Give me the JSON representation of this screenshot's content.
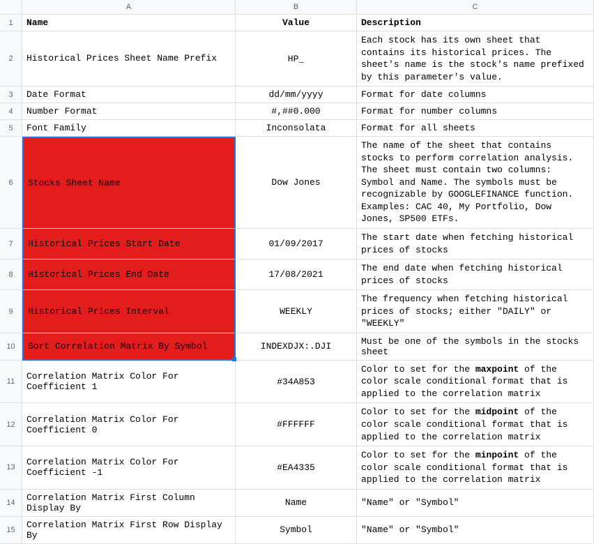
{
  "columns": [
    "A",
    "B",
    "C"
  ],
  "header": {
    "a": "Name",
    "b": "Value",
    "c": "Description"
  },
  "rows": [
    {
      "n": "2",
      "a": "Historical Prices Sheet Name Prefix",
      "b": "HP_",
      "c": "Each stock has its own sheet that contains its historical prices. The sheet's name is the stock's name prefixed by this parameter's value."
    },
    {
      "n": "3",
      "a": "Date Format",
      "b": "dd/mm/yyyy",
      "c": "Format for date columns"
    },
    {
      "n": "4",
      "a": "Number Format",
      "b": "#,##0.000",
      "c": "Format for number columns"
    },
    {
      "n": "5",
      "a": "Font Family",
      "b": "Inconsolata",
      "c": "Format for all sheets"
    },
    {
      "n": "6",
      "a": "Stocks Sheet Name",
      "b": "Dow Jones",
      "c": "The name of the sheet that contains stocks to perform correlation analysis. The sheet must contain two columns: Symbol and Name. The symbols must be recognizable by GOOGLEFINANCE function. Examples: CAC 40, My Portfolio, Dow Jones, SP500 ETFs."
    },
    {
      "n": "7",
      "a": "Historical Prices Start Date",
      "b": "01/09/2017",
      "c": "The start date when fetching historical prices of stocks"
    },
    {
      "n": "8",
      "a": "Historical Prices End Date",
      "b": "17/08/2021",
      "c": "The end date when fetching historical prices of stocks"
    },
    {
      "n": "9",
      "a": "Historical Prices Interval",
      "b": "WEEKLY",
      "c": "The frequency when fetching historical prices of stocks; either \"DAILY\" or \"WEEKLY\""
    },
    {
      "n": "10",
      "a": "Sort Correlation Matrix By Symbol",
      "b": "INDEXDJX:.DJI",
      "c": "Must be one of the symbols in the stocks sheet"
    },
    {
      "n": "11",
      "a": "Correlation Matrix Color For Coefficient 1",
      "b": "#34A853",
      "c_pre": "Color to set for the ",
      "c_bold": "maxpoint",
      "c_post": " of the color scale conditional format that is applied to the correlation matrix"
    },
    {
      "n": "12",
      "a": "Correlation Matrix Color For Coefficient 0",
      "b": "#FFFFFF",
      "c_pre": "Color to set for the ",
      "c_bold": "midpoint",
      "c_post": " of the color scale conditional format that is applied to the correlation matrix"
    },
    {
      "n": "13",
      "a": "Correlation Matrix Color For Coefficient -1",
      "b": "#EA4335",
      "c_pre": "Color to set for the ",
      "c_bold": "minpoint",
      "c_post": " of the color scale conditional format that is applied to the correlation matrix"
    },
    {
      "n": "14",
      "a": "Correlation Matrix First Column Display By",
      "b": "Name",
      "c": "\"Name\" or \"Symbol\""
    },
    {
      "n": "15",
      "a": "Correlation Matrix First Row Display By",
      "b": "Symbol",
      "c": "\"Name\" or \"Symbol\""
    }
  ]
}
